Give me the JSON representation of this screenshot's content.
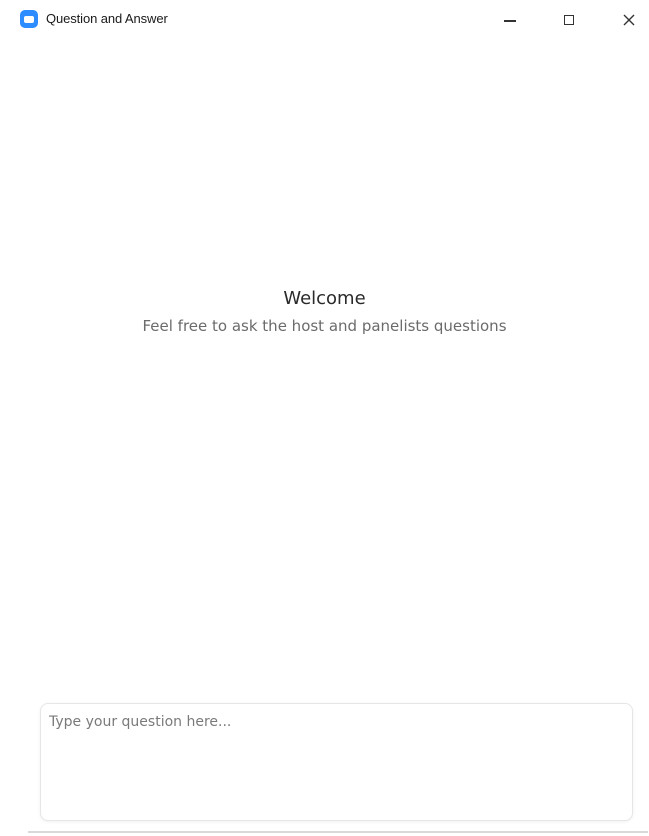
{
  "window": {
    "title": "Question and Answer",
    "icon": "zoom-app-icon",
    "controls": {
      "minimize": "minimize-icon",
      "maximize": "maximize-icon",
      "close": "close-icon"
    }
  },
  "main": {
    "welcome_title": "Welcome",
    "welcome_subtitle": "Feel free to ask the host and panelists questions"
  },
  "composer": {
    "placeholder": "Type your question here...",
    "value": ""
  },
  "colors": {
    "accent": "#2d8cff"
  }
}
